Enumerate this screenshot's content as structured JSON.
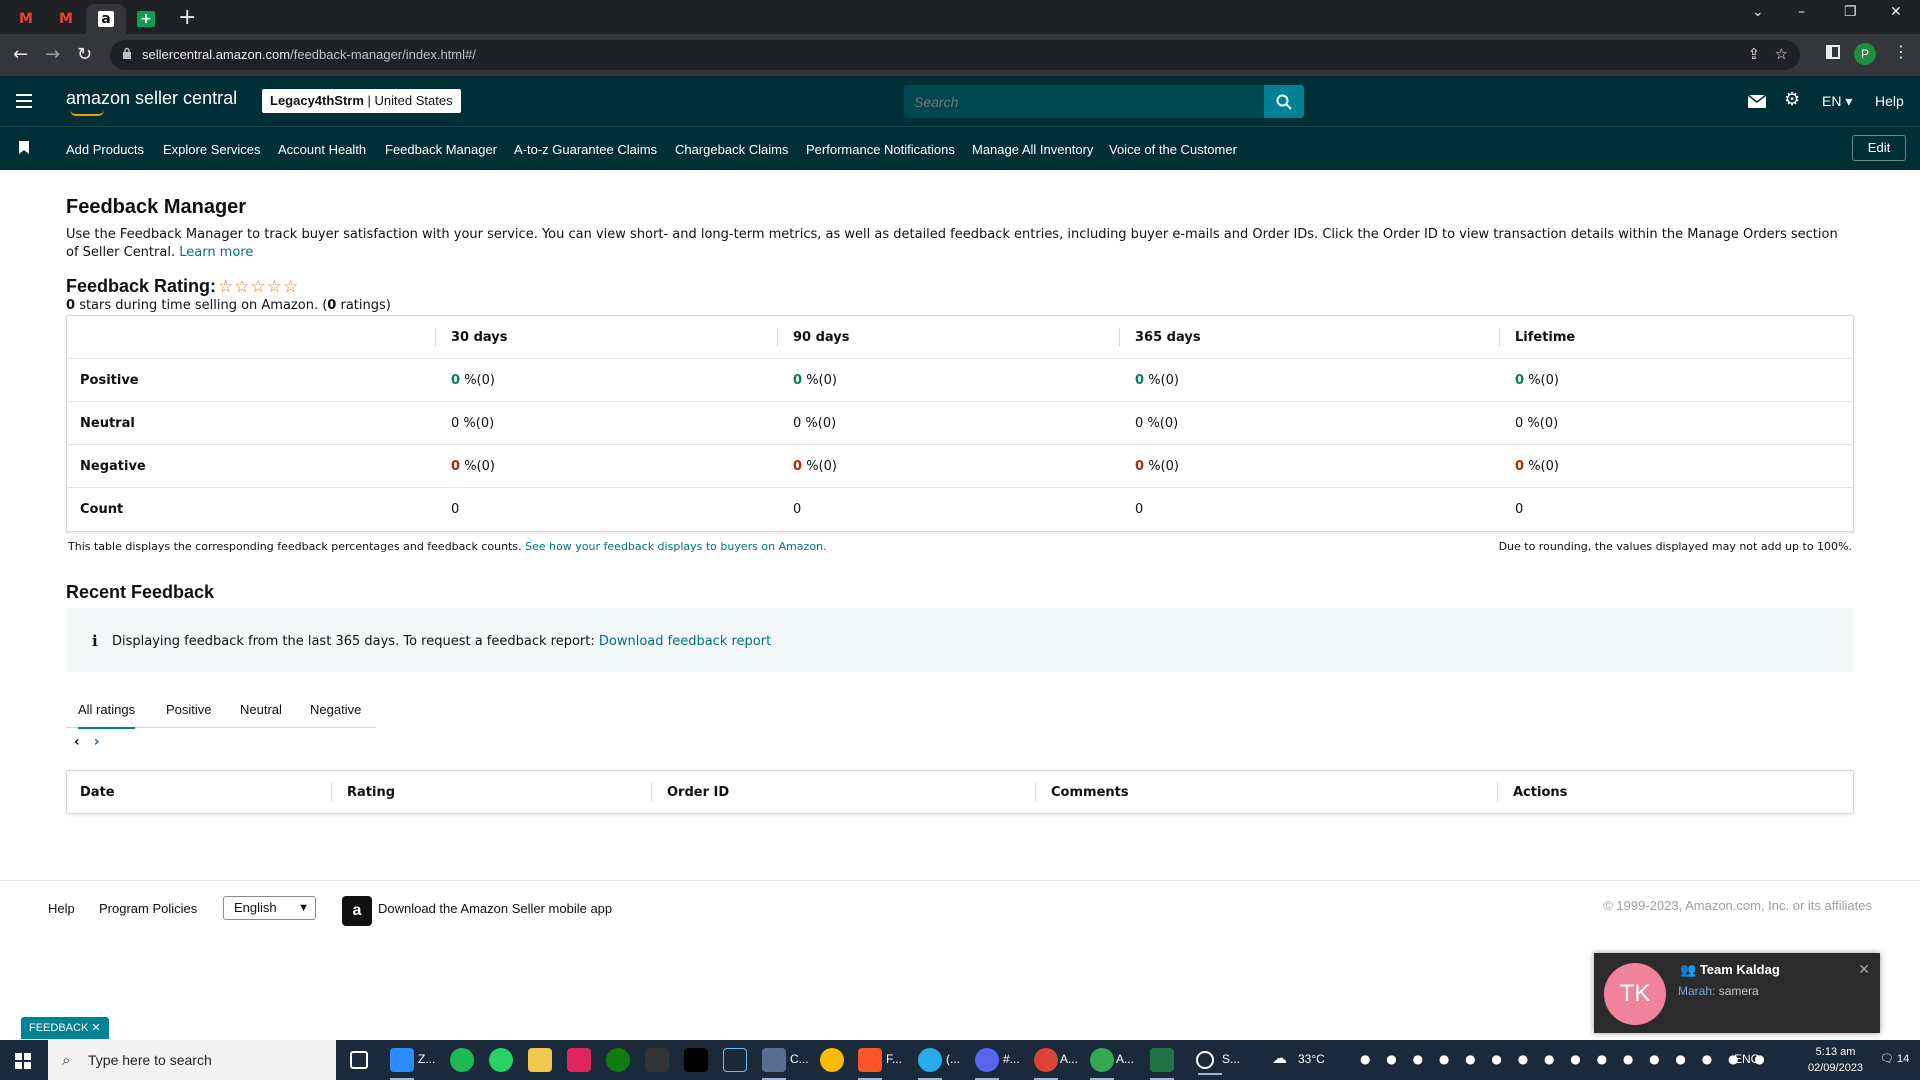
{
  "browser": {
    "tabs": [
      {
        "icon": "gmail-icon",
        "glyph": "M",
        "color": "#ea4335"
      },
      {
        "icon": "gmail-icon",
        "glyph": "M",
        "color": "#ea4335"
      },
      {
        "icon": "amazon-icon",
        "glyph": "a",
        "color": "#111111",
        "active": true
      },
      {
        "icon": "sheets-icon",
        "glyph": "+",
        "color": "#0f9d58"
      }
    ],
    "new_tab": "+",
    "url_host": "sellercentral.amazon.com",
    "url_path": "/feedback-manager/index.html#/",
    "profile_initial": "P"
  },
  "header": {
    "logo_text": "amazon seller central",
    "store_name": "Legacy4thStrm",
    "store_region": "United States",
    "search_placeholder": "Search",
    "language": "EN",
    "help": "Help"
  },
  "shortcuts": {
    "items": [
      "Add Products",
      "Explore Services",
      "Account Health",
      "Feedback Manager",
      "A-to-z Guarantee Claims",
      "Chargeback Claims",
      "Performance Notifications",
      "Manage All Inventory",
      "Voice of the Customer"
    ],
    "edit": "Edit"
  },
  "page": {
    "title": "Feedback Manager",
    "intro": "Use the Feedback Manager to track buyer satisfaction with your service. You can view short- and long-term metrics, as well as detailed feedback entries, including buyer e-mails and Order IDs. Click the Order ID to view transaction details within the Manage Orders section of Seller Central.",
    "learn_more": "Learn more",
    "rating_title": "Feedback Rating:",
    "stars": "☆☆☆☆☆",
    "stars_value": 0,
    "rating_count": "0",
    "rating_sub_a": "stars during time selling on Amazon. (",
    "rating_ratings": "0",
    "rating_sub_b": "ratings)"
  },
  "feedback_table": {
    "columns": [
      "30 days",
      "90 days",
      "365 days",
      "Lifetime"
    ],
    "rows": [
      {
        "label": "Positive",
        "cells": [
          "0",
          "0",
          "0",
          "0"
        ],
        "suffix": "%(0)",
        "tone": "g"
      },
      {
        "label": "Neutral",
        "cells": [
          "0",
          "0",
          "0",
          "0"
        ],
        "suffix": "%(0)",
        "tone": ""
      },
      {
        "label": "Negative",
        "cells": [
          "0",
          "0",
          "0",
          "0"
        ],
        "suffix": "%(0)",
        "tone": "r"
      },
      {
        "label": "Count",
        "cells": [
          "0",
          "0",
          "0",
          "0"
        ],
        "suffix": "",
        "tone": ""
      }
    ],
    "note": "This table displays the corresponding feedback percentages and feedback counts.",
    "note_link": "See how your feedback displays to buyers on Amazon.",
    "note_right": "Due to rounding, the values displayed may not add up to 100%."
  },
  "recent": {
    "title": "Recent Feedback",
    "info_text": "Displaying feedback from the last 365 days. To request a feedback report:",
    "info_link": "Download feedback report",
    "tabs": [
      "All ratings",
      "Positive",
      "Neutral",
      "Negative"
    ],
    "pager_prev": "‹",
    "pager_next": "›",
    "columns": [
      "Date",
      "Rating",
      "Order ID",
      "Comments",
      "Actions"
    ]
  },
  "footer": {
    "help": "Help",
    "policies": "Program Policies",
    "language": "English",
    "app_text": "Download the Amazon Seller mobile app",
    "copyright": "© 1999-2023, Amazon.com, Inc. or its affiliates"
  },
  "feedback_tag": "FEEDBACK ✕",
  "notification": {
    "initials": "TK",
    "title": "Team Kaldag",
    "sender": "Marah:",
    "message": "samera"
  },
  "taskbar": {
    "search_placeholder": "Type here to search",
    "labels": [
      "Z...",
      "C...",
      "F...",
      "(...",
      "#...",
      "A...",
      "A...",
      "S..."
    ],
    "temperature": "33°C",
    "lang": "ENG",
    "time": "5:13 am",
    "date": "02/09/2023",
    "notif_count": "14"
  },
  "colors": {
    "header_bg": "#002f36",
    "accent": "#008296",
    "link": "#007185",
    "positive": "#067d62",
    "negative": "#b12704"
  }
}
